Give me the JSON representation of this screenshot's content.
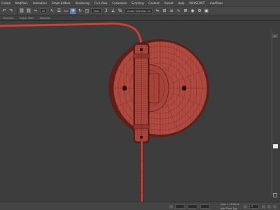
{
  "menubar": {
    "items": [
      "Create",
      "Modifiers",
      "Animation",
      "Graph Editors",
      "Rendering",
      "Civil View",
      "Customize",
      "Scripting",
      "Content",
      "Arnold",
      "Help",
      "MAXSCRIPT",
      "modTools"
    ]
  },
  "toolbar": {
    "filter_dropdown": "All",
    "view_dropdown": "View",
    "selection_set_dropdown": "Create Selection Se"
  },
  "ribbon": {
    "tabs": [
      "Freeform",
      "Object Paint",
      "Populate"
    ]
  },
  "viewport": {
    "label": "",
    "background": "#3d3d3d",
    "object_color": "#b14a40",
    "wire_color": "#5c1d18"
  },
  "statusbar": {
    "left_text": "",
    "grid_text": "Grid = 10.0mm",
    "add_time_tag": "Add Time Tag",
    "frame_value": "0"
  },
  "colors": {
    "ui_dark": "#444444",
    "accent_selected": "#5b7fb0",
    "viewport_bg": "#3d3d3d"
  },
  "icons": [
    "undo-icon",
    "redo-icon",
    "link-icon",
    "unlink-icon",
    "bind-icon",
    "select-object-icon",
    "select-by-name-icon",
    "rectangle-selection-icon",
    "move-icon",
    "rotate-icon",
    "scale-icon",
    "snap-icon",
    "angle-snap-icon",
    "percent-snap-icon",
    "mirror-icon",
    "align-icon",
    "layer-icon",
    "curve-editor-icon",
    "schematic-icon",
    "material-editor-icon",
    "render-setup-icon",
    "render-icon"
  ]
}
